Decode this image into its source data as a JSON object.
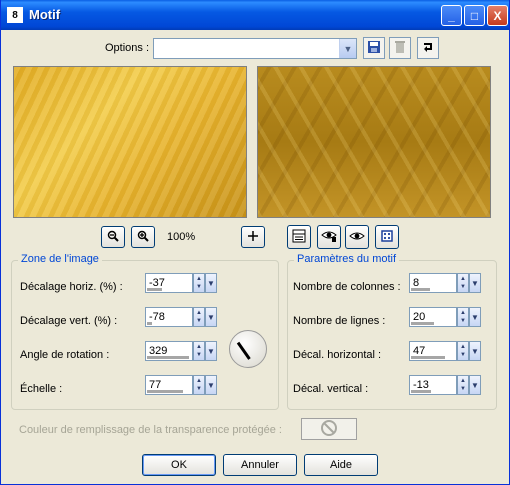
{
  "window": {
    "title": "Motif",
    "title_icon": "8",
    "buttons": {
      "minimize": "_",
      "maximize": "□",
      "close": "X"
    }
  },
  "options": {
    "label": "Options :",
    "value": ""
  },
  "toolbar_icons": {
    "save": "save-icon",
    "delete": "trash-icon",
    "reset": "reset-icon"
  },
  "preview": {
    "zoom_out": "zoom-out-icon",
    "zoom_in": "zoom-in-icon",
    "zoom_level": "100%",
    "pan": "pan-icon"
  },
  "view_buttons": [
    "list-view-icon",
    "eye-dropper-icon",
    "eye-icon",
    "dice-icon"
  ],
  "zone_image": {
    "legend": "Zone de l'image",
    "fields": [
      {
        "label": "Décalage horiz. (%) :",
        "value": "-37",
        "fill": 0.32
      },
      {
        "label": "Décalage vert. (%) :",
        "value": "-78",
        "fill": 0.11
      },
      {
        "label": "Angle de rotation :",
        "value": "329",
        "fill": 0.91
      },
      {
        "label": "Échelle :",
        "value": "77",
        "fill": 0.77
      }
    ]
  },
  "motif_params": {
    "legend": "Paramètres du motif",
    "fields": [
      {
        "label": "Nombre de colonnes :",
        "value": "8",
        "fill": 0.4
      },
      {
        "label": "Nombre de lignes :",
        "value": "20",
        "fill": 0.5
      },
      {
        "label": "Décal. horizontal :",
        "value": "47",
        "fill": 0.74
      },
      {
        "label": "Décal. vertical :",
        "value": "-13",
        "fill": 0.44
      }
    ]
  },
  "fill_color": {
    "label": "Couleur de remplissage de la transparence protégée :"
  },
  "buttons": {
    "ok": "OK",
    "cancel": "Annuler",
    "help": "Aide"
  },
  "colors": {
    "title_bar": "#0054e3",
    "legend_text": "#0046d5",
    "dialog_bg": "#ece9d8"
  }
}
